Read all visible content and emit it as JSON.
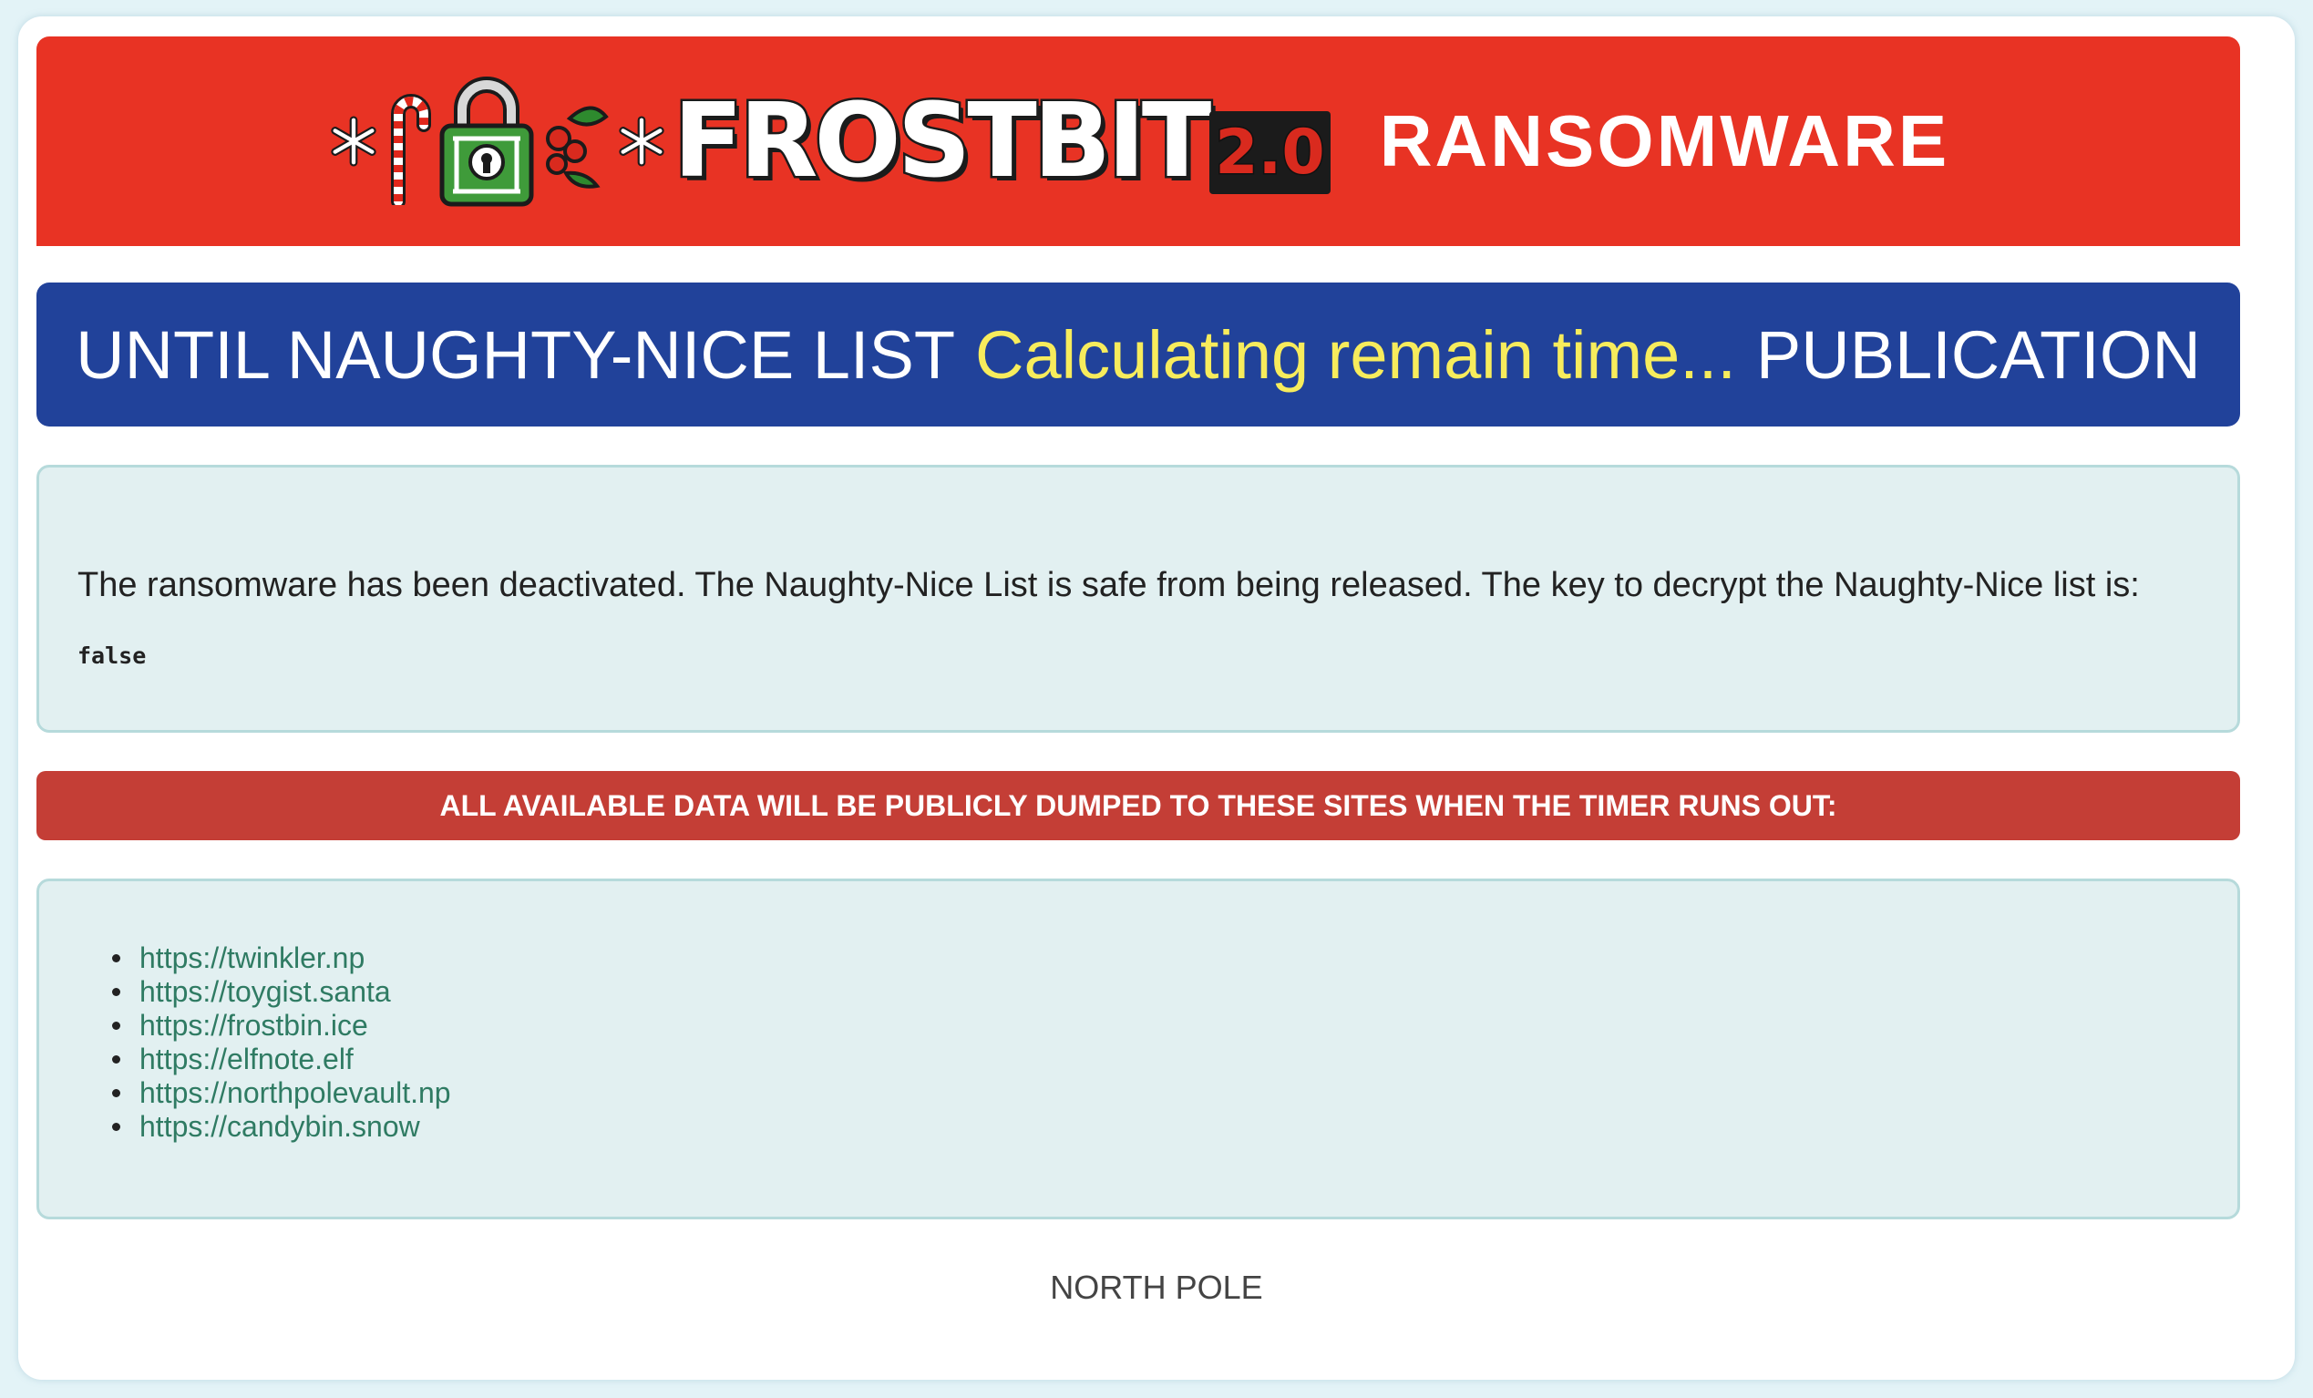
{
  "header": {
    "logo_text": "FROSTBIT",
    "logo_version": "2.0",
    "title": "RANSOMWARE"
  },
  "countdown": {
    "prefix": "UNTIL NAUGHTY-NICE LIST",
    "timer_text": "Calculating remain time...",
    "suffix": "PUBLICATION"
  },
  "message": {
    "text": "The ransomware has been deactivated. The Naughty-Nice List is safe from being released. The key to decrypt the Naughty-Nice list is:",
    "key_value": "false"
  },
  "warning": {
    "text": "ALL AVAILABLE DATA WILL BE PUBLICLY DUMPED TO THESE SITES WHEN THE TIMER RUNS OUT:"
  },
  "sites": [
    {
      "url": "https://twinkler.np"
    },
    {
      "url": "https://toygist.santa"
    },
    {
      "url": "https://frostbin.ice"
    },
    {
      "url": "https://elfnote.elf"
    },
    {
      "url": "https://northpolevault.np"
    },
    {
      "url": "https://candybin.snow"
    }
  ],
  "footer": {
    "text": "NORTH POLE"
  },
  "colors": {
    "header_bg": "#e83324",
    "countdown_bg": "#21429a",
    "timer_text": "#f7ec5c",
    "panel_bg": "#e2f0f1",
    "warning_bg": "#c43e36",
    "link": "#2f7b63"
  },
  "icons": [
    "snowflake-icon",
    "candy-cane-icon",
    "padlock-icon",
    "holly-icon"
  ]
}
